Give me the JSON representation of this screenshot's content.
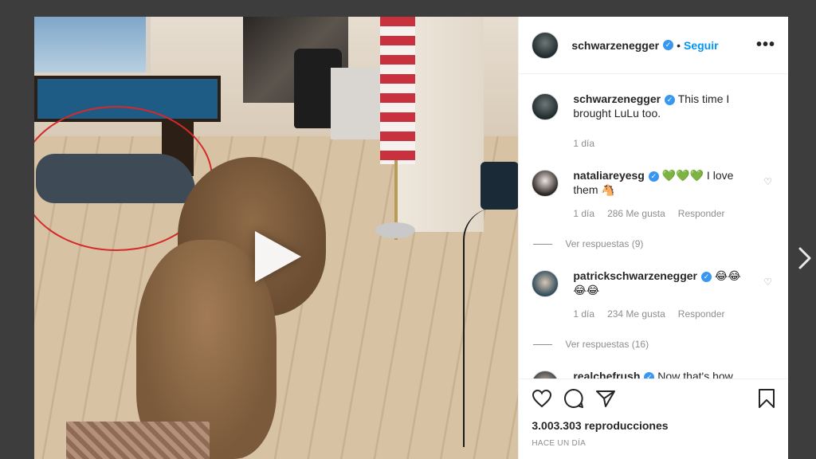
{
  "post": {
    "author": "schwarzenegger",
    "follow_label": "Seguir",
    "dot": "•",
    "more_label": "•••",
    "caption": {
      "author": "schwarzenegger",
      "text": "This time I brought LuLu too.",
      "time": "1 día"
    }
  },
  "comments": [
    {
      "author": "nataliareyesg",
      "text": "💚💚💚 I love them 🐴",
      "time": "1 día",
      "likes": "286 Me gusta",
      "reply_label": "Responder",
      "view_replies": "Ver respuestas (9)"
    },
    {
      "author": "patrickschwarzenegger",
      "text": "😂😂😂😂",
      "time": "1 día",
      "likes": "234 Me gusta",
      "reply_label": "Responder",
      "view_replies": "Ver respuestas (16)"
    },
    {
      "author": "realchefrush",
      "text": "Now that's how"
    }
  ],
  "footer": {
    "views": "3.003.303 reproducciones",
    "ago": "HACE UN DÍA"
  },
  "icons": {
    "verified": "✓",
    "heart": "♡"
  },
  "colors": {
    "accent": "#0095f6",
    "verified": "#3897f0",
    "annotation": "#d42a2a"
  }
}
